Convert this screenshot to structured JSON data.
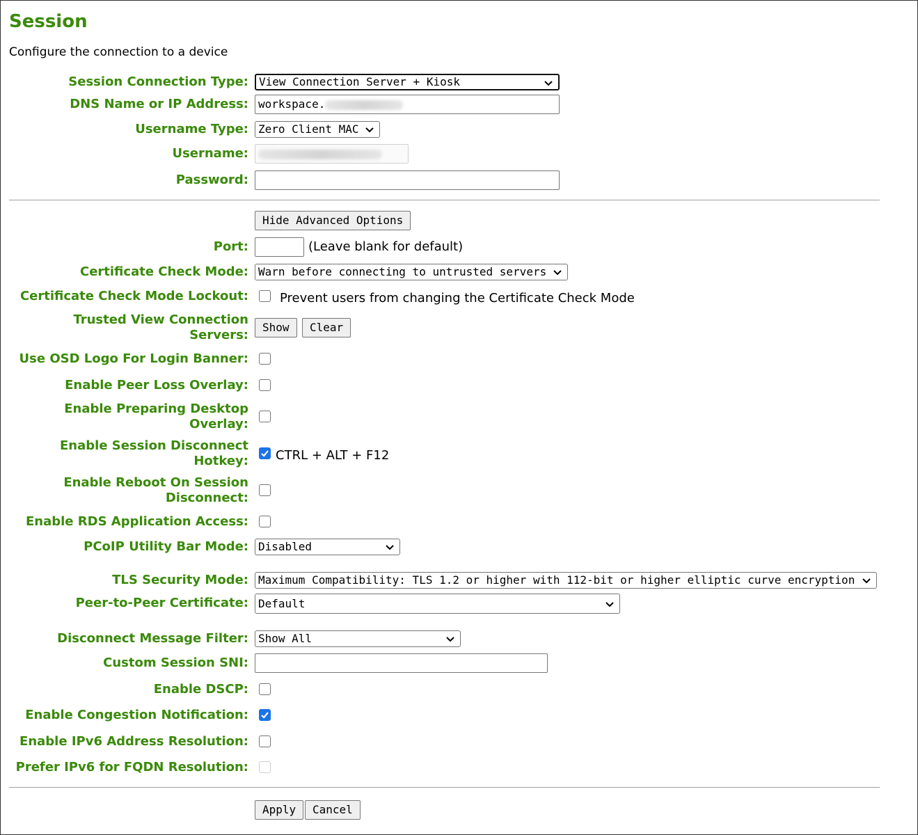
{
  "page": {
    "title": "Session",
    "subtitle": "Configure the connection to a device"
  },
  "basic": {
    "connection_type_label": "Session Connection Type:",
    "connection_type_value": "View Connection Server + Kiosk",
    "dns_label": "DNS Name or IP Address:",
    "dns_value": "workspace.",
    "username_type_label": "Username Type:",
    "username_type_value": "Zero Client MAC",
    "username_label": "Username:",
    "password_label": "Password:"
  },
  "advanced": {
    "toggle_label": "Hide Advanced Options",
    "port_label": "Port:",
    "port_note": "(Leave blank for default)",
    "cert_mode_label": "Certificate Check Mode:",
    "cert_mode_value": "Warn before connecting to untrusted servers",
    "cert_lockout_label": "Certificate Check Mode Lockout:",
    "cert_lockout_note": "Prevent users from changing the Certificate Check Mode",
    "trusted_label_line1": "Trusted View Connection",
    "trusted_label_line2": "Servers:",
    "show_label": "Show",
    "clear_label": "Clear",
    "osd_logo_label": "Use OSD Logo For Login Banner:",
    "peer_loss_label": "Enable Peer Loss Overlay:",
    "preparing_label_line1": "Enable Preparing Desktop",
    "preparing_label_line2": "Overlay:",
    "hotkey_label_line1": "Enable Session Disconnect",
    "hotkey_label_line2": "Hotkey:",
    "hotkey_note": "CTRL + ALT + F12",
    "reboot_label_line1": "Enable Reboot On Session",
    "reboot_label_line2": "Disconnect:",
    "rds_label": "Enable RDS Application Access:",
    "utility_bar_label": "PCoIP Utility Bar Mode:",
    "utility_bar_value": "Disabled",
    "tls_label": "TLS Security Mode:",
    "tls_value": "Maximum Compatibility: TLS 1.2 or higher with 112-bit or higher elliptic curve encryption",
    "p2p_label": "Peer-to-Peer Certificate:",
    "p2p_value": "Default",
    "disconnect_filter_label": "Disconnect Message Filter:",
    "disconnect_filter_value": "Show All",
    "sni_label": "Custom Session SNI:",
    "dscp_label": "Enable DSCP:",
    "congestion_label": "Enable Congestion Notification:",
    "ipv6_label": "Enable IPv6 Address Resolution:",
    "prefer_ipv6_label": "Prefer IPv6 for FQDN Resolution:"
  },
  "actions": {
    "apply_label": "Apply",
    "cancel_label": "Cancel"
  },
  "colors": {
    "label_green": "#3a8a0a",
    "checkbox_blue": "#1a73e8"
  }
}
